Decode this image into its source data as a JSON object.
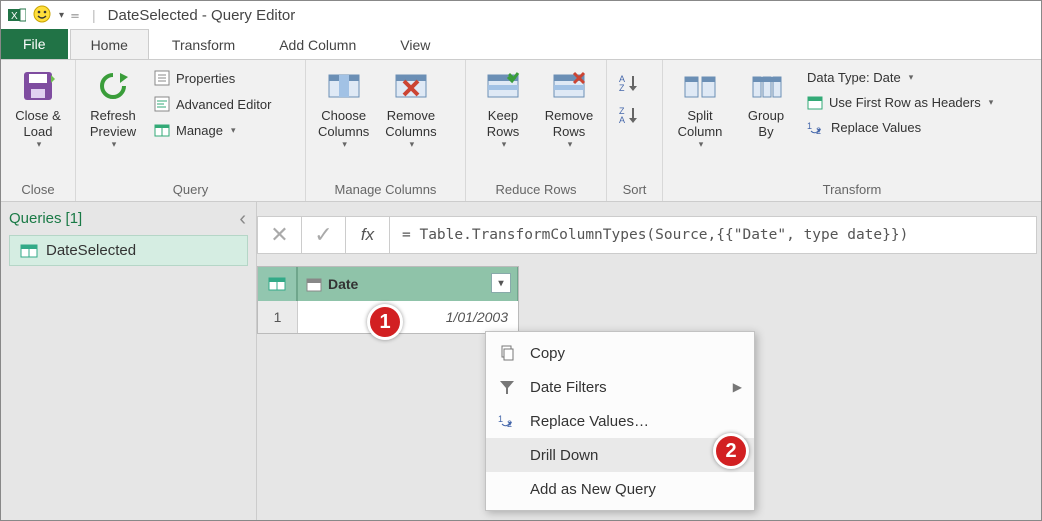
{
  "titlebar": {
    "title": "DateSelected - Query Editor"
  },
  "tabs": {
    "file": "File",
    "home": "Home",
    "transform": "Transform",
    "addcolumn": "Add Column",
    "view": "View"
  },
  "ribbon": {
    "close": {
      "label": "Close &\nLoad",
      "group": "Close"
    },
    "query": {
      "refresh": "Refresh\nPreview",
      "properties": "Properties",
      "advanced": "Advanced Editor",
      "manage": "Manage",
      "group": "Query"
    },
    "managecols": {
      "choose": "Choose\nColumns",
      "remove": "Remove\nColumns",
      "group": "Manage Columns"
    },
    "reducerows": {
      "keep": "Keep\nRows",
      "remove": "Remove\nRows",
      "group": "Reduce Rows"
    },
    "sort": {
      "group": "Sort"
    },
    "transform": {
      "split": "Split\nColumn",
      "groupby": "Group\nBy",
      "datatype": "Data Type: Date",
      "firstrow": "Use First Row as Headers",
      "replace": "Replace Values",
      "group": "Transform"
    }
  },
  "queries": {
    "title": "Queries",
    "count": "[1]",
    "items": [
      "DateSelected"
    ]
  },
  "formula": "= Table.TransformColumnTypes(Source,{{\"Date\", type date}})",
  "grid": {
    "col1": "Date",
    "rows": [
      {
        "idx": "1",
        "value": "1/01/2003"
      }
    ]
  },
  "contextmenu": {
    "copy": "Copy",
    "filters": "Date Filters",
    "replace": "Replace Values…",
    "drilldown": "Drill Down",
    "addnew": "Add as New Query"
  },
  "annotations": {
    "badge1": "1",
    "badge2": "2"
  }
}
